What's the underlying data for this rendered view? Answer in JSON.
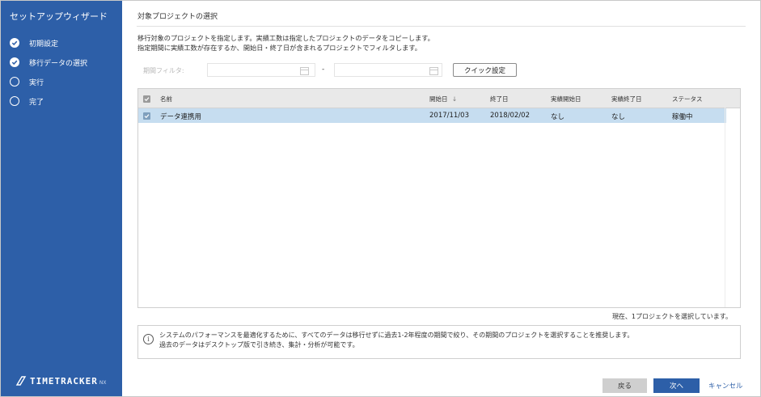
{
  "sidebar": {
    "title": "セットアップウィザード",
    "steps": [
      {
        "label": "初期設定",
        "state": "done"
      },
      {
        "label": "移行データの選択",
        "state": "done"
      },
      {
        "label": "実行",
        "state": "todo"
      },
      {
        "label": "完了",
        "state": "todo"
      }
    ],
    "logo_text": "TIMETRACKER",
    "logo_suffix": "NX"
  },
  "main": {
    "title": "対象プロジェクトの選択",
    "description_line1": "移行対象のプロジェクトを指定します。実績工数は指定したプロジェクトのデータをコピーします。",
    "description_line2": "指定期間に実績工数が存在するか、開始日・終了日が含まれるプロジェクトでフィルタします。"
  },
  "filter": {
    "label": "期間フィルタ:",
    "from_value": "",
    "to_value": "",
    "separator": "-",
    "quick_button": "クイック設定"
  },
  "table": {
    "columns": [
      "名前",
      "開始日",
      "終了日",
      "実績開始日",
      "実績終了日",
      "ステータス"
    ],
    "sort_indicator": "↓",
    "rows": [
      {
        "checked": true,
        "name": "データ連携用",
        "start": "2017/11/03",
        "end": "2018/02/02",
        "actual_start": "なし",
        "actual_end": "なし",
        "status": "稼働中"
      }
    ]
  },
  "selection_status": "現在、1プロジェクトを選択しています。",
  "info": {
    "line1": "システムのパフォーマンスを最適化するために、すべてのデータは移行せずに過去1-2年程度の期間で絞り、その期間のプロジェクトを選択することを推奨します。",
    "line2": "過去のデータはデスクトップ版で引き続き、集計・分析が可能です。"
  },
  "footer": {
    "back": "戻る",
    "next": "次へ",
    "cancel": "キャンセル"
  },
  "colors": {
    "sidebar_bg": "#2d5fa8",
    "selected_row": "#c6ddf0",
    "primary": "#2d5fa8"
  }
}
